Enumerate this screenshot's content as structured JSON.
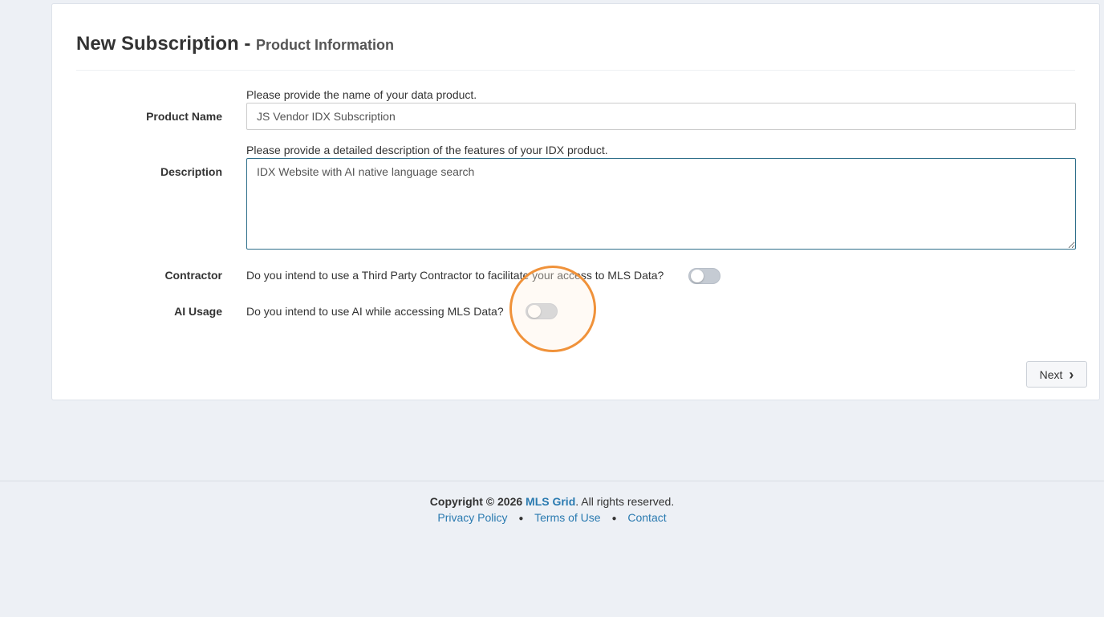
{
  "page": {
    "title": "New Subscription -",
    "subtitle": "Product Information"
  },
  "form": {
    "product_name": {
      "label": "Product Name",
      "help": "Please provide the name of your data product.",
      "value": "JS Vendor IDX Subscription"
    },
    "description": {
      "label": "Description",
      "help": "Please provide a detailed description of the features of your IDX product.",
      "value": "IDX Website with AI native language search"
    },
    "contractor": {
      "label": "Contractor",
      "question": "Do you intend to use a Third Party Contractor to facilitate your access to MLS Data?",
      "enabled": false
    },
    "ai_usage": {
      "label": "AI Usage",
      "question": "Do you intend to use AI while accessing MLS Data?",
      "enabled": false
    }
  },
  "actions": {
    "next_label": "Next",
    "next_icon": "chevron-right-icon"
  },
  "footer": {
    "copyright_prefix": "Copyright © 2026",
    "brand": "MLS Grid",
    "copyright_suffix": ". All rights reserved.",
    "links": [
      "Privacy Policy",
      "Terms of Use",
      "Contact"
    ],
    "separator": "●"
  },
  "colors": {
    "accent": "#2a7ab0",
    "click_highlight": "#f0923a",
    "page_bg": "#edf0f5"
  }
}
